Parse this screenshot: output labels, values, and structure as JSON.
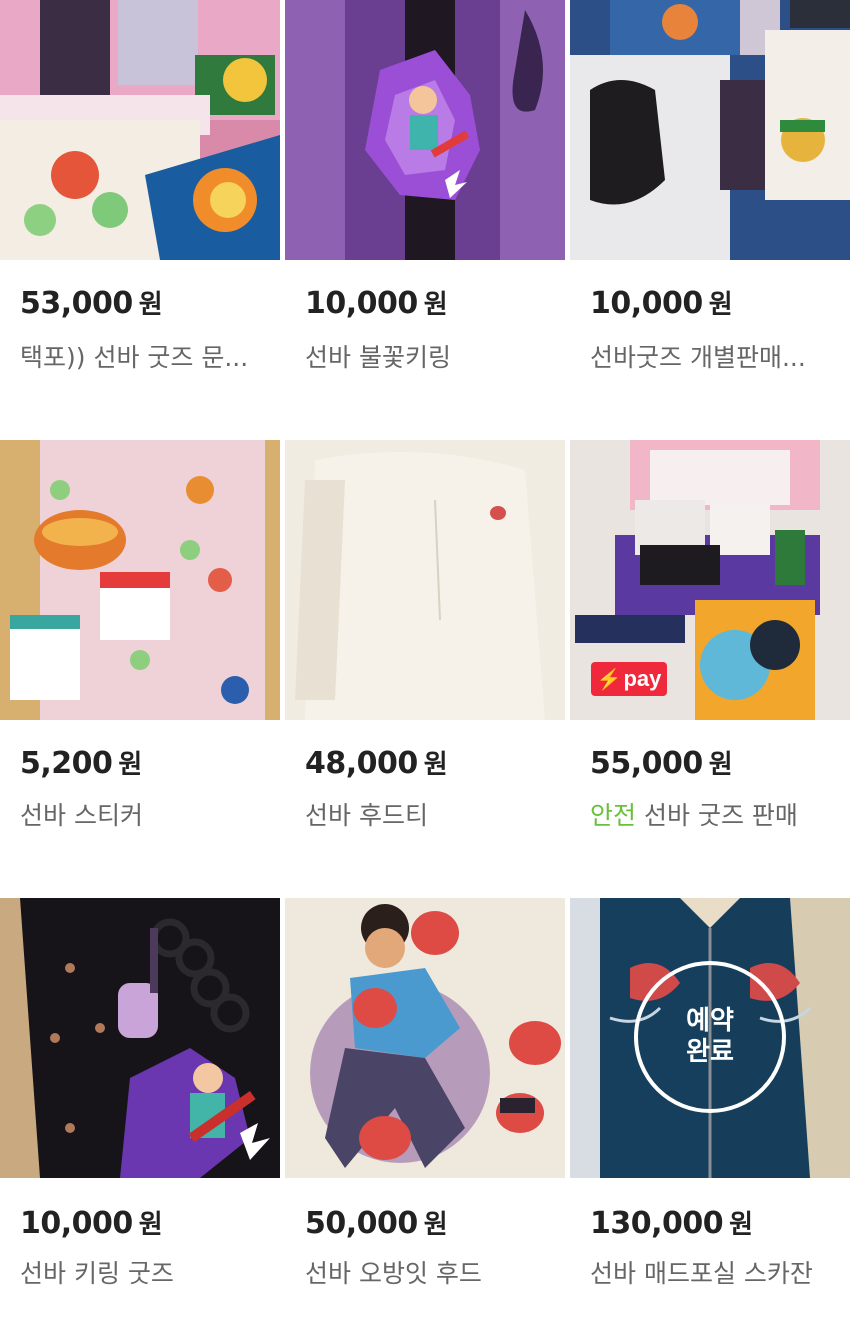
{
  "currency": "원",
  "listings": [
    {
      "price": "53,000",
      "title": "택포)) 선바 굿즈 문...",
      "badge": "",
      "safe": ""
    },
    {
      "price": "10,000",
      "title": "선바 불꽃키링",
      "badge": "",
      "safe": ""
    },
    {
      "price": "10,000",
      "title": "선바굿즈 개별판매...",
      "badge": "",
      "safe": ""
    },
    {
      "price": "5,200",
      "title": "선바 스티커",
      "badge": "",
      "safe": ""
    },
    {
      "price": "48,000",
      "title": "선바 후드티",
      "badge": "",
      "safe": ""
    },
    {
      "price": "55,000",
      "title": "선바 굿즈 판매",
      "badge": "pay",
      "safe": "안전"
    },
    {
      "price": "10,000",
      "title": "선바 키링 굿즈",
      "badge": "",
      "safe": ""
    },
    {
      "price": "50,000",
      "title": "선바 오방잇 후드",
      "badge": "",
      "safe": ""
    },
    {
      "price": "130,000",
      "title": "선바 매드포실 스카잔",
      "badge": "",
      "safe": ""
    }
  ],
  "reserved_overlay": {
    "line1": "예약",
    "line2": "완료"
  },
  "pay_badge": {
    "icon": "lightning-bolt-icon",
    "label": "pay",
    "color": "#f0283c"
  },
  "colors": {
    "safe_text": "#6bbf3f",
    "price_text": "#222222",
    "title_text": "#666666"
  }
}
